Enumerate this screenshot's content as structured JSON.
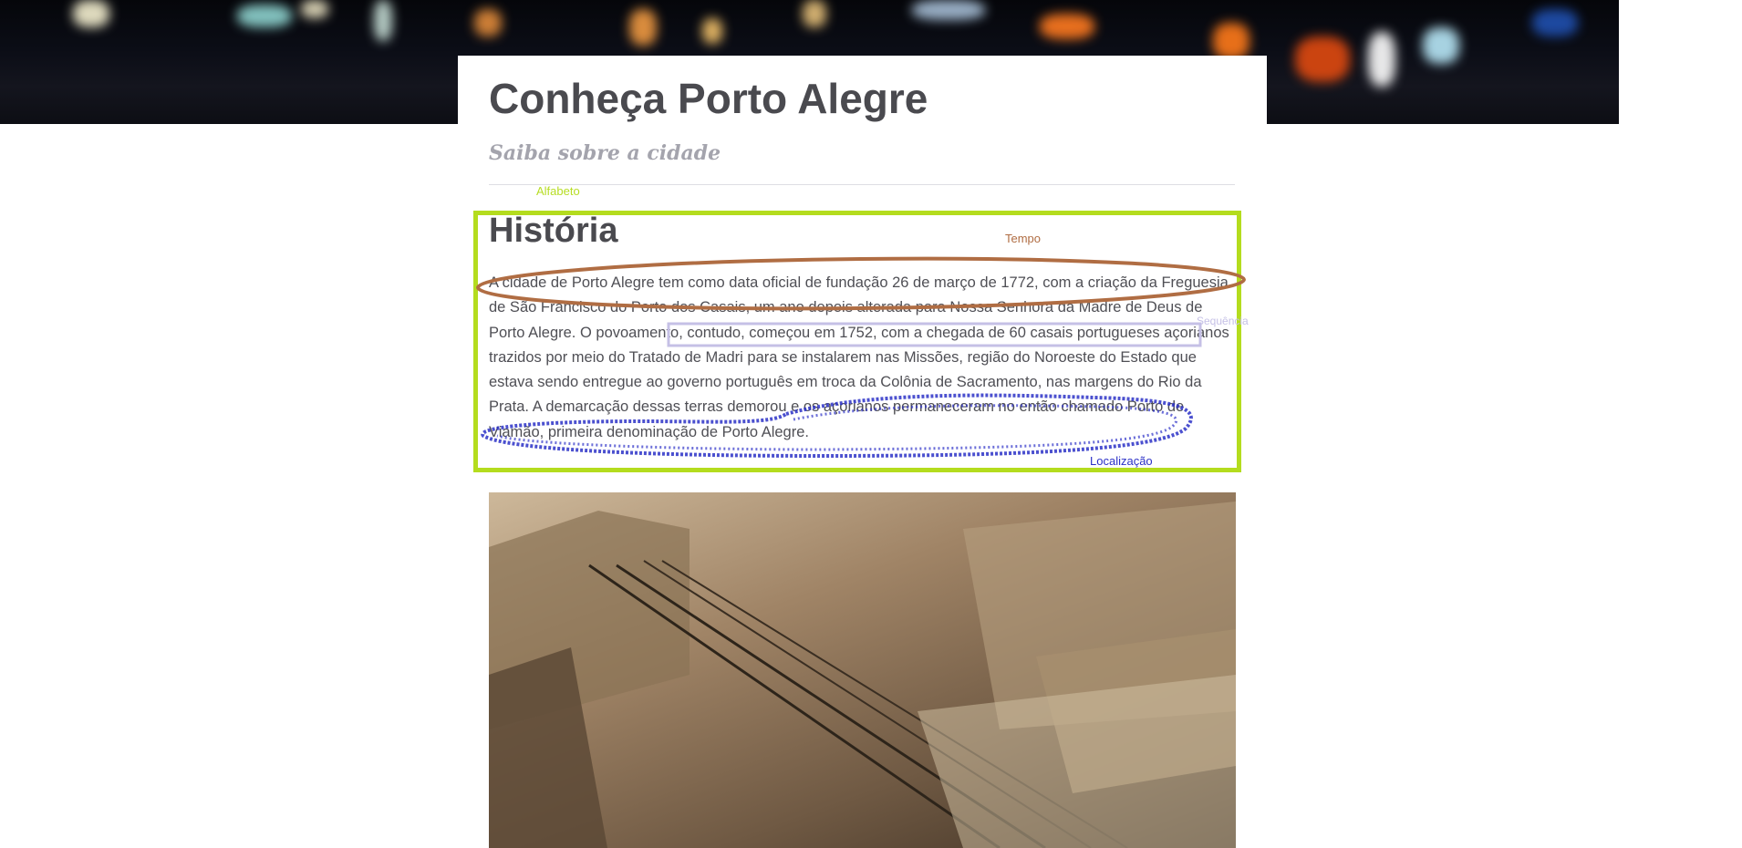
{
  "header": {
    "title": "Conheça Porto Alegre",
    "subtitle": "Saiba sobre a cidade"
  },
  "section": {
    "heading": "História",
    "paragraph": "A cidade de Porto Alegre tem como data oficial de fundação 26 de março de 1772, com a criação da Freguesia de São Francisco do Porto dos Casais, um ano depois alterada para Nossa Senhora da Madre de Deus de Porto Alegre. O povoamento, contudo, começou em 1752, com a chegada de 60 casais portugueses açorianos trazidos por meio do Tratado de Madri para se instalarem nas Missões, região do Noroeste do Estado que estava sendo entregue ao governo português em troca da Colônia de Sacramento, nas margens do Rio da Prata. A demarcação dessas terras demorou e os açorianos permaneceram no então chamado Porto de Viamão, primeira denominação de Porto Alegre."
  },
  "annotations": {
    "alfabeto": "Alfabeto",
    "tempo": "Tempo",
    "sequencia": "Sequência",
    "localizacao": "Localização"
  },
  "colors": {
    "alfabeto": "#b4dc1e",
    "tempo": "#b06d43",
    "sequencia": "#c5c0e6",
    "localizacao": "#2c31c7"
  },
  "images": {
    "header_image": "night-city-lights-over-water",
    "historic_photo": "sepia-historic-street-with-railway-tracks"
  }
}
